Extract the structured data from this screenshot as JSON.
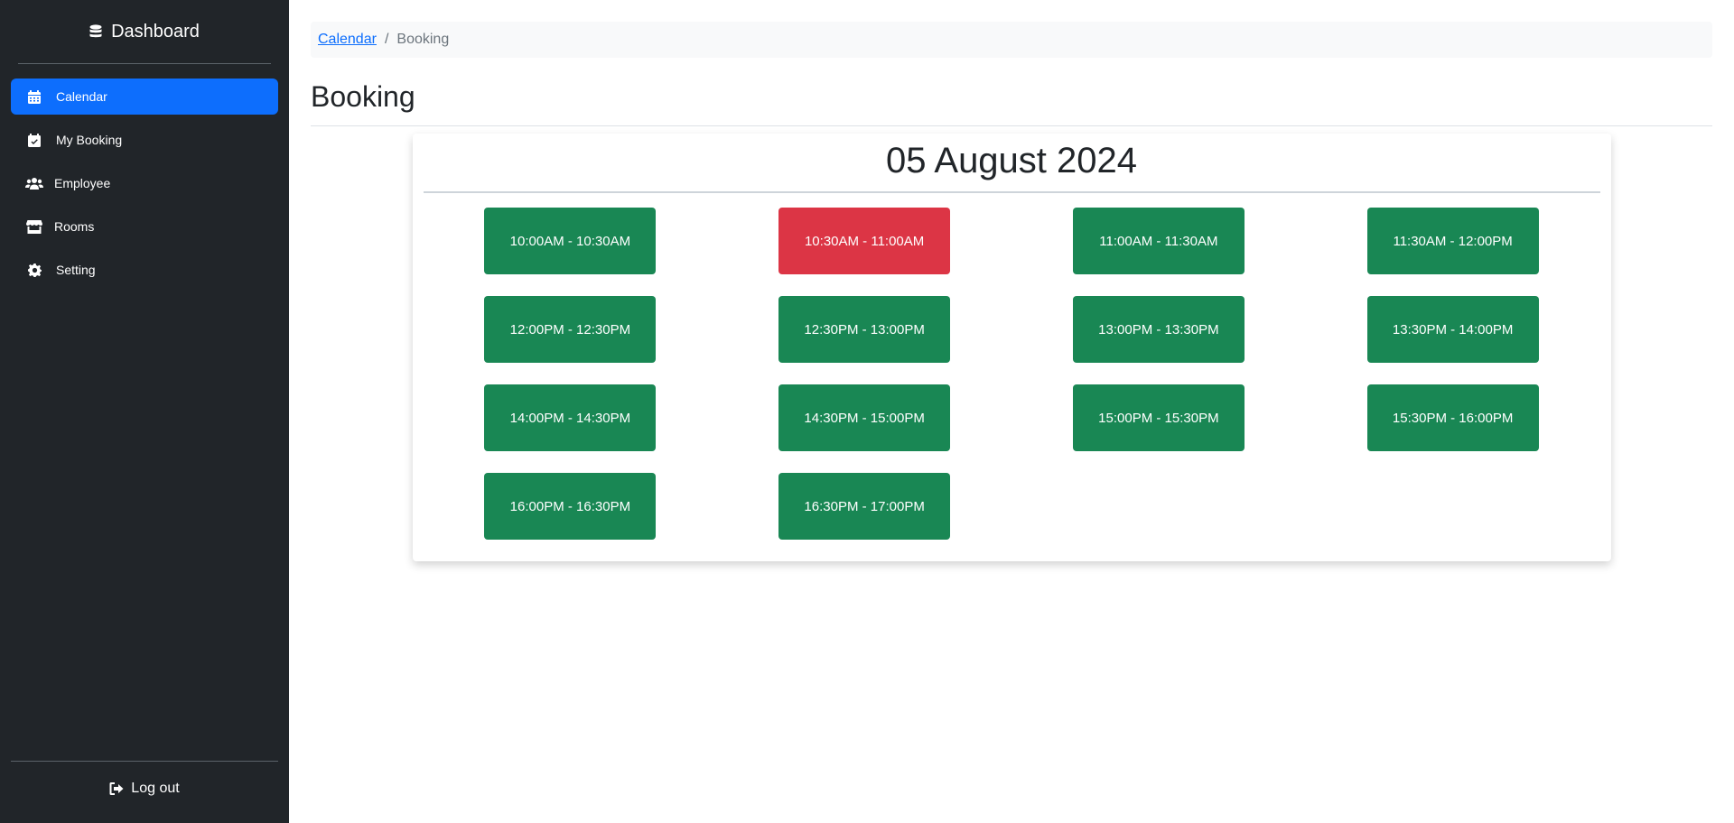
{
  "sidebar": {
    "brand": {
      "label": "Dashboard",
      "icon": "database-icon"
    },
    "items": [
      {
        "label": "Calendar",
        "icon": "calendar-icon",
        "active": true
      },
      {
        "label": "My Booking",
        "icon": "calendar-check-icon",
        "active": false
      },
      {
        "label": "Employee",
        "icon": "users-icon",
        "active": false
      },
      {
        "label": "Rooms",
        "icon": "store-icon",
        "active": false
      },
      {
        "label": "Setting",
        "icon": "gear-icon",
        "active": false
      }
    ],
    "logout": {
      "label": "Log out",
      "icon": "sign-out-icon"
    }
  },
  "breadcrumb": {
    "link": "Calendar",
    "separator": "/",
    "current": "Booking"
  },
  "page_title": "Booking",
  "date_heading": "05 August 2024",
  "slots": [
    {
      "label": "10:00AM - 10:30AM",
      "status": "available"
    },
    {
      "label": "10:30AM - 11:00AM",
      "status": "booked"
    },
    {
      "label": "11:00AM - 11:30AM",
      "status": "available"
    },
    {
      "label": "11:30AM - 12:00PM",
      "status": "available"
    },
    {
      "label": "12:00PM - 12:30PM",
      "status": "available"
    },
    {
      "label": "12:30PM - 13:00PM",
      "status": "available"
    },
    {
      "label": "13:00PM - 13:30PM",
      "status": "available"
    },
    {
      "label": "13:30PM - 14:00PM",
      "status": "available"
    },
    {
      "label": "14:00PM - 14:30PM",
      "status": "available"
    },
    {
      "label": "14:30PM - 15:00PM",
      "status": "available"
    },
    {
      "label": "15:00PM - 15:30PM",
      "status": "available"
    },
    {
      "label": "15:30PM - 16:00PM",
      "status": "available"
    },
    {
      "label": "16:00PM - 16:30PM",
      "status": "available"
    },
    {
      "label": "16:30PM - 17:00PM",
      "status": "available"
    }
  ],
  "colors": {
    "sidebar_bg": "#212529",
    "active": "#0d6efd",
    "available": "#198754",
    "booked": "#dc3545"
  }
}
